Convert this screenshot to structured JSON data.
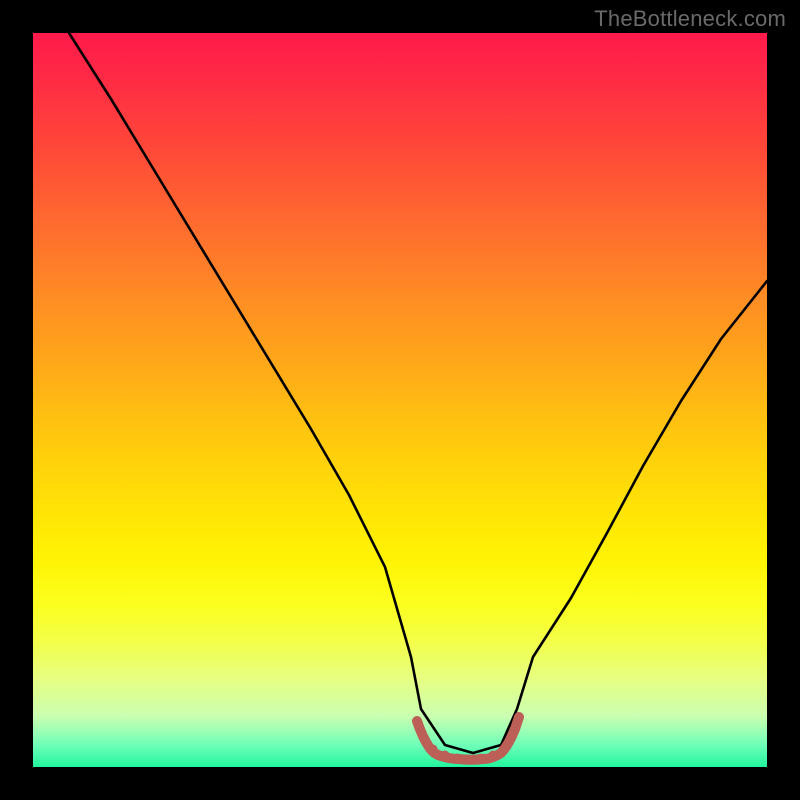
{
  "watermark": "TheBottleneck.com",
  "chart_data": {
    "type": "line",
    "title": "",
    "xlabel": "",
    "ylabel": "",
    "xlim": [
      0,
      1
    ],
    "ylim": [
      0,
      1
    ],
    "gradient_description": "vertical gradient red (top) through orange, yellow, to green (bottom) representing bottleneck severity",
    "series": [
      {
        "name": "bottleneck-curve",
        "color": "#000000",
        "x": [
          0.05,
          0.1,
          0.15,
          0.2,
          0.25,
          0.3,
          0.35,
          0.4,
          0.45,
          0.5,
          0.52,
          0.56,
          0.6,
          0.64,
          0.66,
          0.7,
          0.75,
          0.8,
          0.85,
          0.9,
          0.95,
          1.0
        ],
        "y": [
          1.0,
          0.91,
          0.82,
          0.73,
          0.64,
          0.55,
          0.46,
          0.37,
          0.27,
          0.15,
          0.08,
          0.03,
          0.02,
          0.03,
          0.08,
          0.15,
          0.23,
          0.32,
          0.41,
          0.5,
          0.58,
          0.66
        ]
      },
      {
        "name": "flat-bottom-marker",
        "color": "#c06058",
        "x": [
          0.52,
          0.535,
          0.545,
          0.555,
          0.565,
          0.575,
          0.585,
          0.595,
          0.605,
          0.615,
          0.625,
          0.635,
          0.645,
          0.66
        ],
        "y": [
          0.065,
          0.035,
          0.025,
          0.02,
          0.018,
          0.017,
          0.017,
          0.017,
          0.018,
          0.02,
          0.025,
          0.035,
          0.05,
          0.075
        ]
      }
    ]
  }
}
